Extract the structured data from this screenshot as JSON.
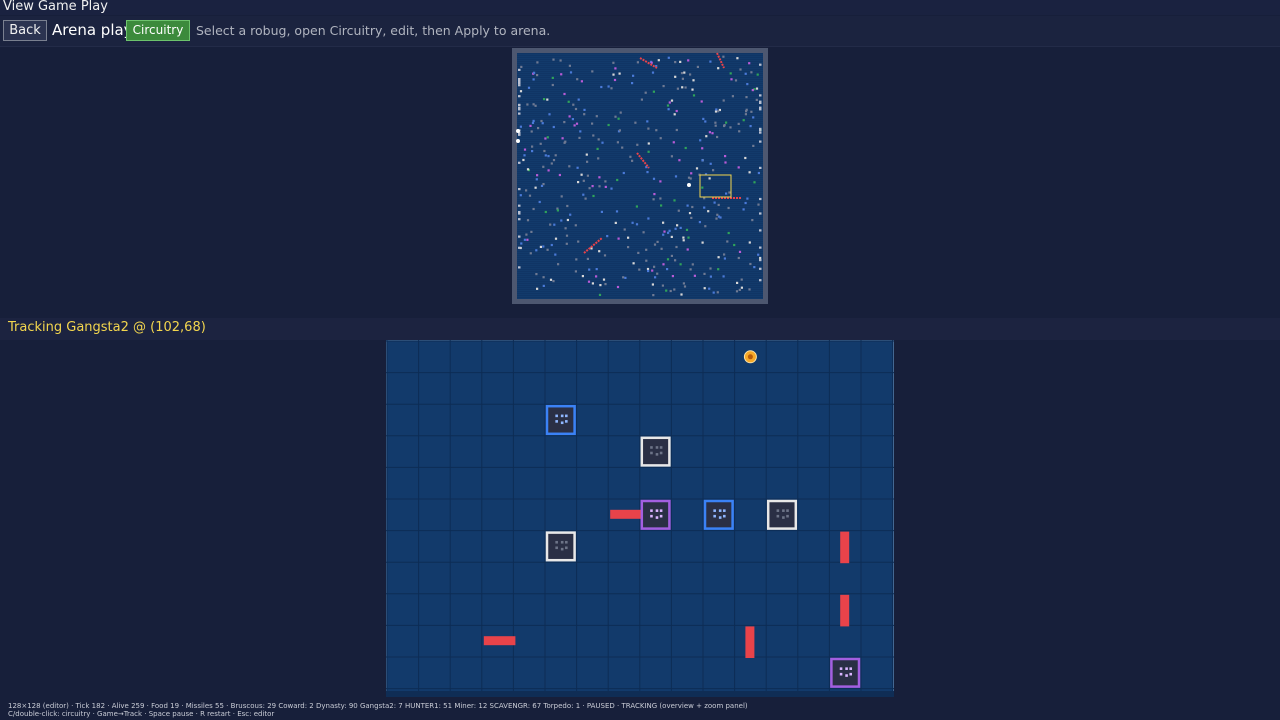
{
  "window": {
    "title": "View Game Play"
  },
  "toolbar": {
    "back_label": "Back",
    "mode_label": "Arena play",
    "circuitry_label": "Circuitry",
    "hint": "Select a robug, open Circuitry, edit, then Apply to arena."
  },
  "tracking": {
    "text": "Tracking Gangsta2 @ (102,68)"
  },
  "status": {
    "line1": "128×128 (editor)  ·  Tick 182  ·  Alive 259  ·  Food 19  ·  Missiles 55  ·  Bruscous: 29  Coward: 2  Dynasty: 90  Gangsta2: 7  HUNTER1: 51  Miner: 12  SCAVENGR: 67  Torpedo: 1  ·  PAUSED  ·  TRACKING (overview + zoom panel)",
    "line2": "C/double-click: circuitry · Game→Track · Space pause · R restart · Esc: editor"
  },
  "colors": {
    "background": "#171f3a",
    "arena": "#123a6b",
    "frame": "#4d5770",
    "missile": "#e8434a",
    "food": "#f7a928",
    "tracked_highlight": "#f3d64e",
    "robug_white": "#e8e8e8",
    "robug_blue": "#3b82f6",
    "robug_purple": "#a35fe0"
  },
  "zoom_panel": {
    "grid": {
      "cols": 16,
      "rows": 11
    },
    "robugs": [
      {
        "col": 5,
        "row": 2,
        "kind": "blue"
      },
      {
        "col": 8,
        "row": 3,
        "kind": "white"
      },
      {
        "col": 8,
        "row": 5,
        "kind": "purple"
      },
      {
        "col": 10,
        "row": 5,
        "kind": "blue"
      },
      {
        "col": 12,
        "row": 5,
        "kind": "white"
      },
      {
        "col": 5,
        "row": 6,
        "kind": "white"
      },
      {
        "col": 14,
        "row": 10,
        "kind": "purple"
      }
    ],
    "missiles": [
      {
        "col": 7,
        "row": 5,
        "dir": "h"
      },
      {
        "col": 14,
        "row": 6,
        "dir": "v"
      },
      {
        "col": 14,
        "row": 8,
        "dir": "v"
      },
      {
        "col": 3,
        "row": 9,
        "dir": "h"
      },
      {
        "col": 11,
        "row": 9,
        "dir": "v"
      }
    ],
    "food": [
      {
        "col": 11,
        "row": 0
      }
    ]
  }
}
